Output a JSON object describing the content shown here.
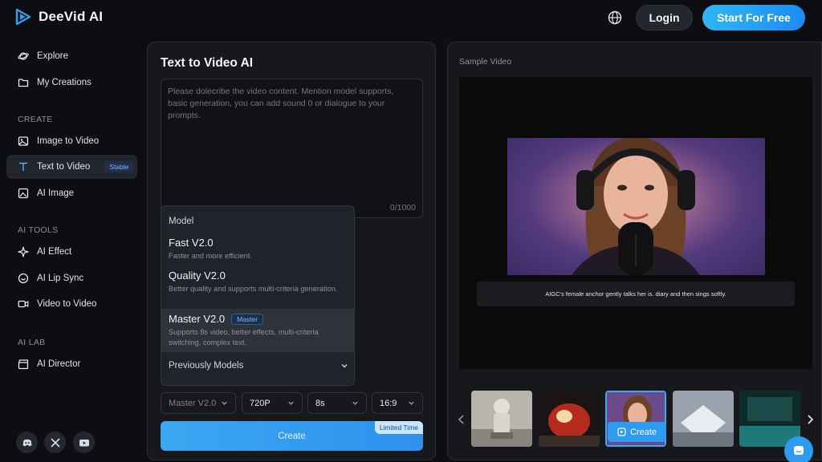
{
  "header": {
    "brand": "DeeVid AI",
    "login_label": "Login",
    "start_label": "Start For Free"
  },
  "sidebar": {
    "top_items": [
      {
        "label": "Explore",
        "icon": "planet-icon"
      },
      {
        "label": "My Creations",
        "icon": "folder-icon"
      }
    ],
    "create_section": "CREATE",
    "create_items": [
      {
        "label": "Image to Video",
        "icon": "image-icon"
      },
      {
        "label": "Text to Video",
        "icon": "text-icon",
        "badge": "Stable",
        "active": true
      },
      {
        "label": "AI Image",
        "icon": "ai-image-icon"
      }
    ],
    "tools_section": "AI TOOLS",
    "tools_items": [
      {
        "label": "AI Effect",
        "icon": "sparkle-icon"
      },
      {
        "label": "AI Lip Sync",
        "icon": "lips-icon"
      },
      {
        "label": "Video to Video",
        "icon": "video-icon"
      }
    ],
    "lab_section": "AI LAB",
    "lab_items": [
      {
        "label": "AI Director",
        "icon": "clapper-icon"
      }
    ],
    "social": [
      "discord-icon",
      "x-icon",
      "youtube-icon"
    ]
  },
  "generator": {
    "title": "Text to Video AI",
    "prompt_placeholder": "Please dolecribe the video content. Mention model supports, basic generation, you can add sound 0 or dialogue to your prompts.",
    "prompt_counter": "0/1000",
    "model_dropdown": {
      "header": "Model",
      "options": [
        {
          "name": "Fast V2.0",
          "desc": "Faster and more efficient."
        },
        {
          "name": "Quality V2.0",
          "desc": "Better quality and supports multi-criteria generation."
        },
        {
          "name": "Master V2.0",
          "badge": "Master",
          "desc": "Supports 8s video, better effects, multi-criteria switching, complex text.",
          "selected": true
        }
      ],
      "previous": "Previously Models"
    },
    "selects": {
      "model": "Master V2.0",
      "resolution": "720P",
      "duration": "8s",
      "ratio": "16:9"
    },
    "create_label": "Create",
    "limited_label": "Limited Time"
  },
  "preview": {
    "label": "Sample Video",
    "caption": "AIGC's female anchor gently talks her is. diary and then sings softly.",
    "thumb_create_label": "Create"
  },
  "colors": {
    "accent": "#2d9bf0",
    "background": "#0d0e11",
    "panel": "#16181c"
  }
}
